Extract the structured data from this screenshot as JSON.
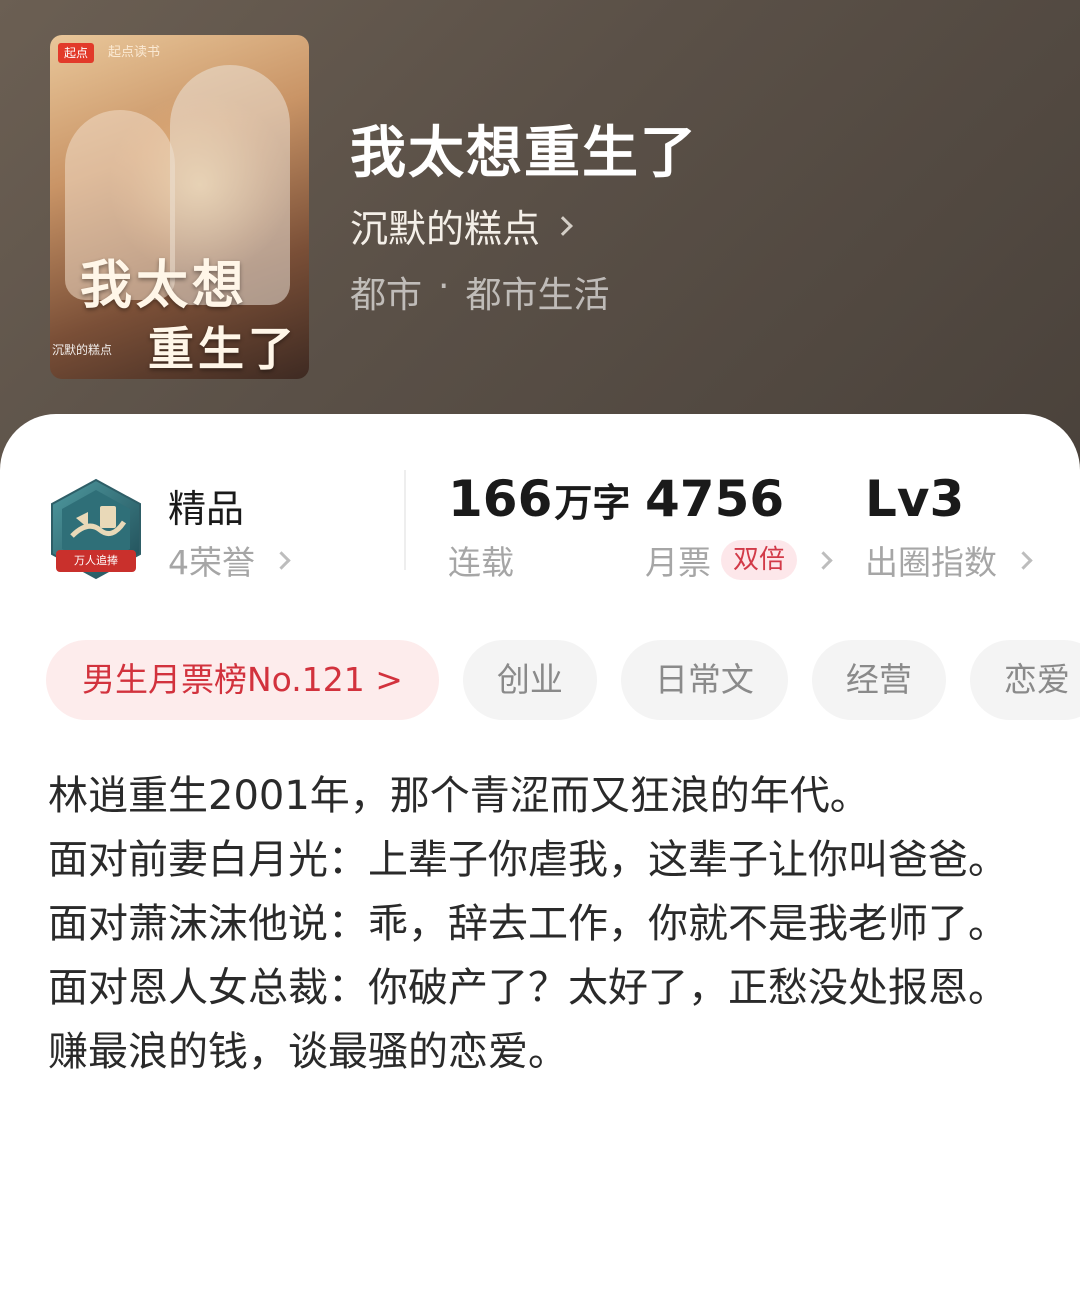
{
  "header": {
    "cover": {
      "logo": "起点",
      "brand": "起点读书",
      "title_line1": "我太想",
      "title_line2": "重生了",
      "author": "沉默的糕点"
    },
    "title": "我太想重生了",
    "author": "沉默的糕点",
    "genre": "都市",
    "subgenre": "都市生活",
    "genre_separator": "·"
  },
  "stats": {
    "honor": {
      "label": "精品",
      "count": "4荣誉",
      "badge_text": "万人追捧"
    },
    "words": {
      "value": "166",
      "unit": "万字",
      "label": "连载"
    },
    "monthly_ticket": {
      "value": "4756",
      "label": "月票",
      "tag": "双倍"
    },
    "circle_index": {
      "value": "Lv3",
      "label": "出圈指数"
    }
  },
  "tags": {
    "rank": "男生月票榜No.121 >",
    "items": [
      "创业",
      "日常文",
      "经营",
      "恋爱"
    ]
  },
  "synopsis": [
    "林逍重生2001年，那个青涩而又狂浪的年代。",
    "面对前妻白月光：上辈子你虐我，这辈子让你叫爸爸。",
    "面对萧沫沫他说：乖，辞去工作，你就不是我老师了。",
    "面对恩人女总裁：你破产了？太好了，正愁没处报恩。",
    "赚最浪的钱，谈最骚的恋爱。"
  ],
  "colors": {
    "accent": "#d2323d",
    "hero_background": "#5a5047",
    "tag_background": "#f4f4f4"
  }
}
